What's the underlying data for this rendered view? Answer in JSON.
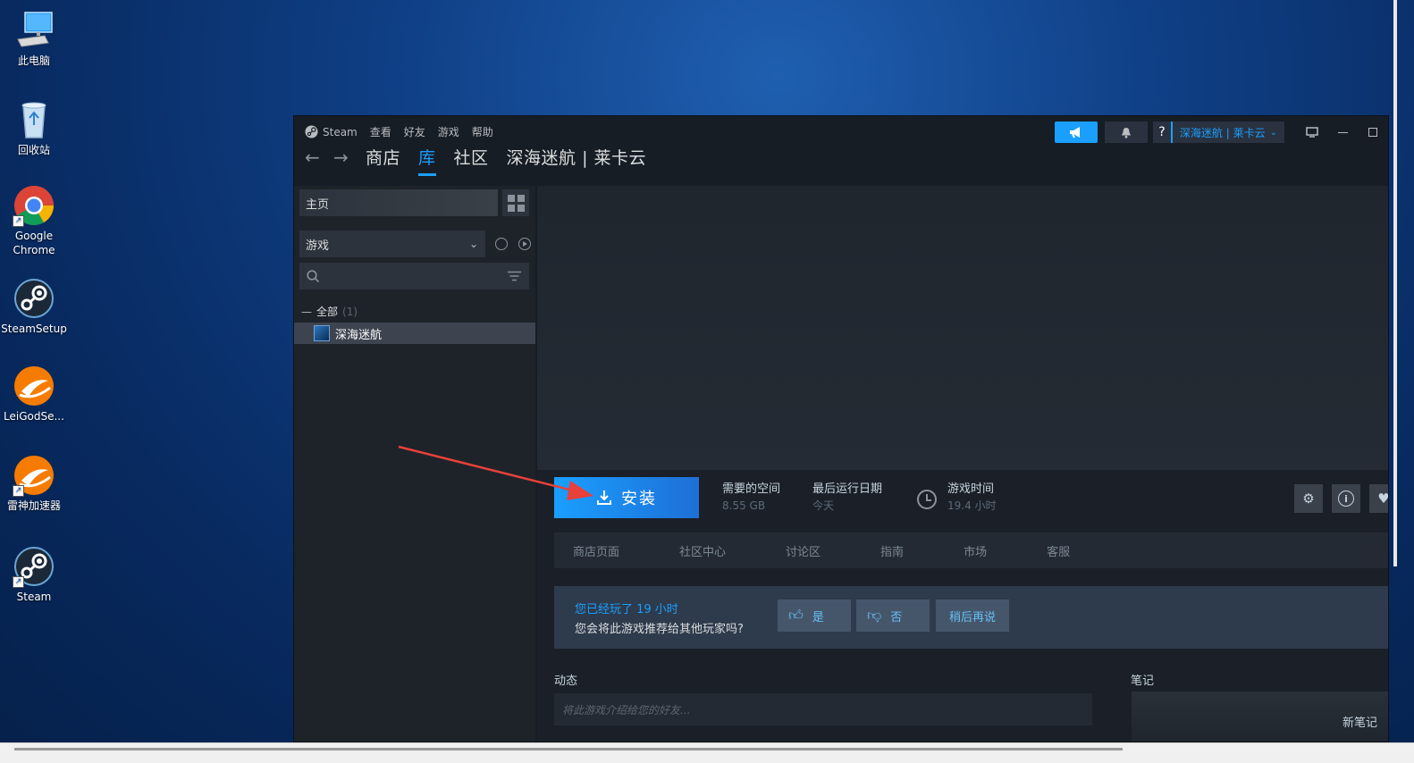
{
  "desktop": {
    "icons": [
      {
        "label": "此电脑"
      },
      {
        "label": "回收站"
      },
      {
        "label": "Google Chrome"
      },
      {
        "label": "SteamSetup"
      },
      {
        "label": "LeiGodSe..."
      },
      {
        "label": "雷神加速器"
      },
      {
        "label": "Steam"
      }
    ]
  },
  "steam": {
    "menu": {
      "brand": "Steam",
      "items": [
        "查看",
        "好友",
        "游戏",
        "帮助"
      ]
    },
    "nav": {
      "store": "商店",
      "library": "库",
      "community": "社区",
      "profile": "深海迷航 | 莱卡云"
    },
    "top_right": {
      "help": "?",
      "account": "深海迷航 | 莱卡云"
    },
    "sidebar": {
      "home": "主页",
      "filter": "游戏",
      "category": "全部",
      "category_count": "(1)",
      "game": "深海迷航"
    },
    "game": {
      "install_label": "安装",
      "space_label": "需要的空间",
      "space_value": "8.55 GB",
      "last_run_label": "最后运行日期",
      "last_run_value": "今天",
      "playtime_label": "游戏时间",
      "playtime_value": "19.4 小时"
    },
    "tabs": [
      "商店页面",
      "社区中心",
      "讨论区",
      "指南",
      "市场",
      "客服"
    ],
    "review": {
      "played": "您已经玩了 19 小时",
      "question": "您会将此游戏推荐给其他玩家吗?",
      "yes": "是",
      "no": "否",
      "later": "稍后再说"
    },
    "activity": {
      "label": "动态",
      "placeholder": "将此游戏介绍给您的好友..."
    },
    "notes": {
      "label": "笔记",
      "new_note": "新笔记"
    }
  },
  "colors": {
    "accent": "#1a9fff",
    "window_bg": "#171d25",
    "annotation_arrow": "#e8403a"
  }
}
